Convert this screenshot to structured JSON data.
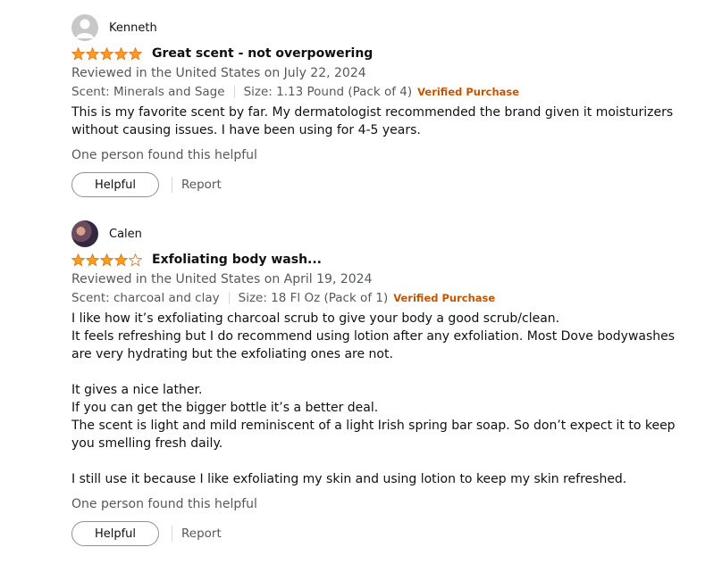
{
  "reviews": [
    {
      "reviewer": "Kenneth",
      "avatar": "generic-user-avatar",
      "rating": 5,
      "max_rating": 5,
      "star_color": "#f89f1b",
      "title": "Great scent - not overpowering",
      "date_line": "Reviewed in the United States on July 22, 2024",
      "scent": "Scent: Minerals and Sage",
      "size": "Size: 1.13 Pound (Pack of 4)",
      "verified": "Verified Purchase",
      "body": [
        "This is my favorite scent by far. My dermatologist recommended the brand given it moisturizers without causing issues. I have been using for 4-5 years."
      ],
      "helpful_count_text": "One person found this helpful",
      "helpful_button": "Helpful",
      "report_link": "Report"
    },
    {
      "reviewer": "Calen",
      "avatar": "user-photo-avatar",
      "rating": 4,
      "max_rating": 5,
      "star_color": "#f89f1b",
      "title": "Exfoliating body wash...",
      "date_line": "Reviewed in the United States on April 19, 2024",
      "scent": "Scent: charcoal and clay",
      "size": "Size: 18 Fl Oz (Pack of 1)",
      "verified": "Verified Purchase",
      "body": [
        "I like how it’s exfoliating charcoal scrub to give your body a good scrub/clean.",
        "It feels refreshing but I do recommend using lotion after any exfoliation. Most Dove bodywashes are very hydrating but the exfoliating ones are not.",
        "",
        "It gives a nice lather.",
        "If you can get the bigger bottle it’s a better deal.",
        "The scent is light and mild reminiscent of a light Irish spring bar soap. So don’t expect it to keep you smelling fresh daily.",
        "",
        "I still use it because I like exfoliating my skin and using lotion to keep my skin refreshed."
      ],
      "helpful_count_text": "One person found this helpful",
      "helpful_button": "Helpful",
      "report_link": "Report"
    }
  ]
}
